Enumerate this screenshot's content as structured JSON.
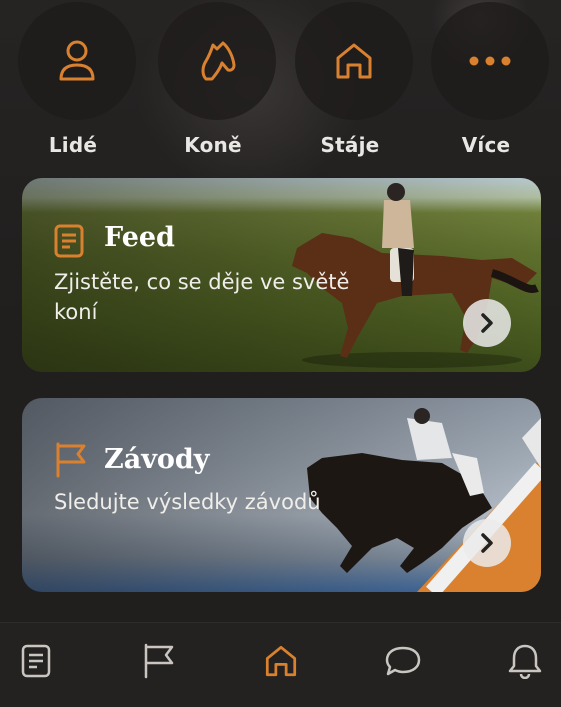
{
  "quick_actions": [
    {
      "label": "Lidé",
      "icon": "person-icon"
    },
    {
      "label": "Koně",
      "icon": "horse-head-icon"
    },
    {
      "label": "Stáje",
      "icon": "house-icon"
    },
    {
      "label": "Více",
      "icon": "more-dots-icon"
    }
  ],
  "cards": {
    "feed": {
      "title": "Feed",
      "subtitle": "Zjistěte, co se děje ve světě koní",
      "icon": "document-icon"
    },
    "races": {
      "title": "Závody",
      "subtitle": "Sledujte výsledky závodů",
      "icon": "flag-icon"
    }
  },
  "bottom_nav": [
    {
      "icon": "document-icon",
      "active": false
    },
    {
      "icon": "flag-icon",
      "active": false
    },
    {
      "icon": "home-icon",
      "active": true
    },
    {
      "icon": "chat-bubble-icon",
      "active": false
    },
    {
      "icon": "bell-icon",
      "active": false
    }
  ],
  "colors": {
    "accent": "#d9812f",
    "background": "#211f1e",
    "icon_inactive": "#c9c6c2"
  }
}
